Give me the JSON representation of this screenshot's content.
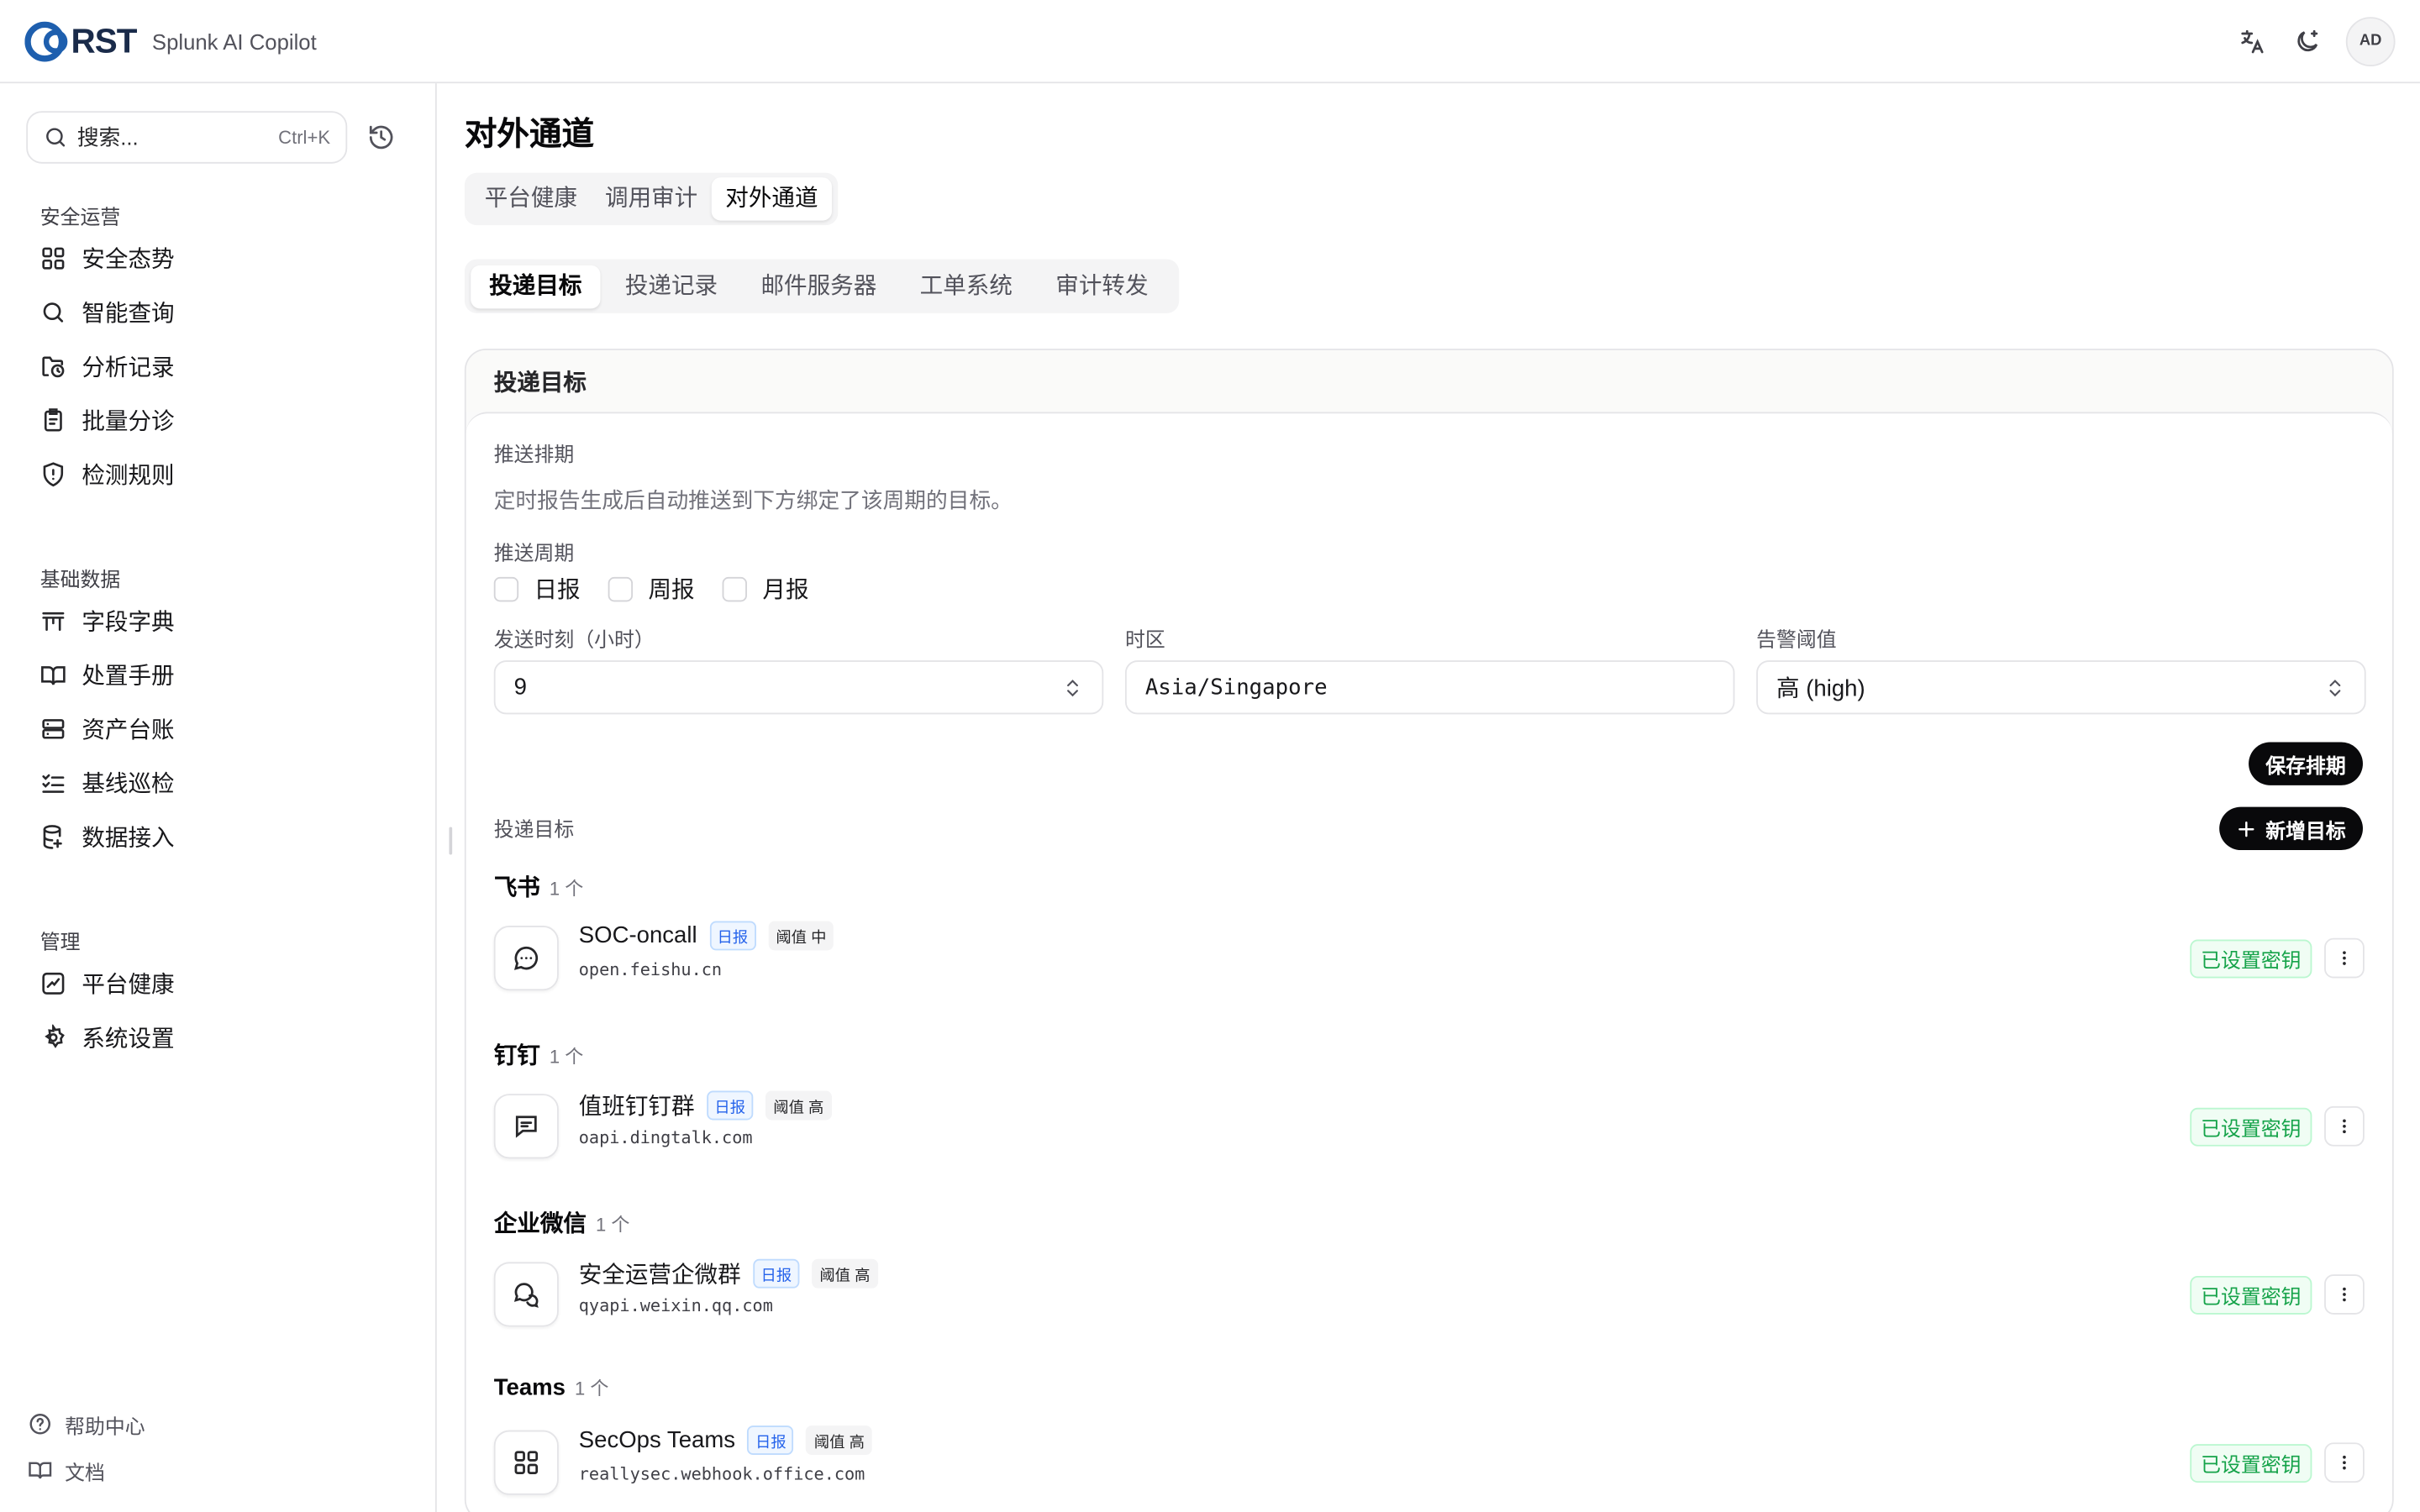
{
  "topbar": {
    "logo_text": "RST",
    "app_name": "Splunk AI Copilot",
    "avatar": "AD",
    "icons": [
      "translate-icon",
      "theme-moon-icon"
    ]
  },
  "search": {
    "placeholder": "搜索...",
    "shortcut": "Ctrl+K"
  },
  "sidebar": {
    "groups": [
      {
        "title": "安全运营",
        "items": [
          {
            "label": "安全态势",
            "icon": "grid-icon"
          },
          {
            "label": "智能查询",
            "icon": "search-icon"
          },
          {
            "label": "分析记录",
            "icon": "folder-clock-icon"
          },
          {
            "label": "批量分诊",
            "icon": "clipboard-icon"
          },
          {
            "label": "检测规则",
            "icon": "shield-alert-icon"
          }
        ]
      },
      {
        "title": "基础数据",
        "items": [
          {
            "label": "字段字典",
            "icon": "table-icon"
          },
          {
            "label": "处置手册",
            "icon": "book-icon"
          },
          {
            "label": "资产台账",
            "icon": "server-icon"
          },
          {
            "label": "基线巡检",
            "icon": "list-check-icon"
          },
          {
            "label": "数据接入",
            "icon": "database-icon"
          }
        ]
      },
      {
        "title": "管理",
        "items": [
          {
            "label": "平台健康",
            "icon": "activity-icon"
          },
          {
            "label": "系统设置",
            "icon": "gear-icon"
          }
        ]
      }
    ],
    "footer": [
      {
        "label": "帮助中心",
        "icon": "help-icon"
      },
      {
        "label": "文档",
        "icon": "book-open-icon"
      }
    ]
  },
  "page": {
    "title": "对外通道",
    "tabs": [
      "平台健康",
      "调用审计",
      "对外通道"
    ],
    "active_tab": "对外通道",
    "subtabs": [
      "投递目标",
      "投递记录",
      "邮件服务器",
      "工单系统",
      "审计转发"
    ],
    "active_subtab": "投递目标"
  },
  "card": {
    "title": "投递目标",
    "schedule": {
      "heading": "推送排期",
      "description": "定时报告生成后自动推送到下方绑定了该周期的目标。",
      "period_label": "推送周期",
      "periods": [
        {
          "label": "日报",
          "checked": false
        },
        {
          "label": "周报",
          "checked": false
        },
        {
          "label": "月报",
          "checked": false
        }
      ],
      "hour_label": "发送时刻（小时）",
      "hour_value": "9",
      "tz_label": "时区",
      "tz_value": "Asia/Singapore",
      "threshold_label": "告警阈值",
      "threshold_value": "高 (high)",
      "save_label": "保存排期"
    },
    "targets_label": "投递目标",
    "add_label": "新增目标",
    "groups": [
      {
        "title": "飞书",
        "count": "1 个",
        "items": [
          {
            "name": "SOC-oncall",
            "period": "日报",
            "threshold": "阈值 中",
            "host": "open.feishu.cn",
            "status": "已设置密钥",
            "icon": "chat-bubble-icon"
          }
        ]
      },
      {
        "title": "钉钉",
        "count": "1 个",
        "items": [
          {
            "name": "值班钉钉群",
            "period": "日报",
            "threshold": "阈值 高",
            "host": "oapi.dingtalk.com",
            "status": "已设置密钥",
            "icon": "message-square-icon"
          }
        ]
      },
      {
        "title": "企业微信",
        "count": "1 个",
        "items": [
          {
            "name": "安全运营企微群",
            "period": "日报",
            "threshold": "阈值 高",
            "host": "qyapi.weixin.qq.com",
            "status": "已设置密钥",
            "icon": "chats-icon"
          }
        ]
      },
      {
        "title": "Teams",
        "count": "1 个",
        "items": [
          {
            "name": "SecOps Teams",
            "period": "日报",
            "threshold": "阈值 高",
            "host": "reallysec.webhook.office.com",
            "status": "已设置密钥",
            "icon": "grid-icon"
          }
        ]
      }
    ]
  },
  "colors": {
    "accent_dark": "#09090b",
    "logo_blue": "#1e5fae",
    "badge_blue": "#2563eb",
    "status_green": "#16a34a"
  }
}
